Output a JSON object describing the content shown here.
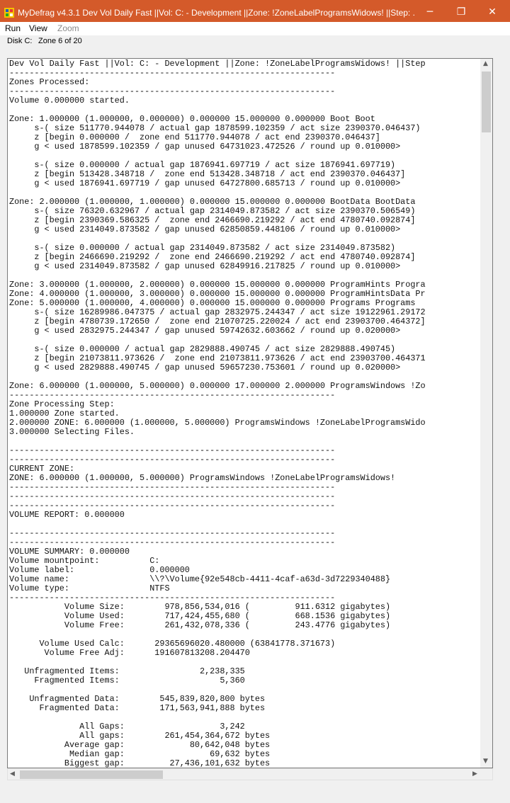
{
  "window": {
    "title": "MyDefrag v4.3.1   Dev Vol Daily Fast ||Vol: C: - Development ||Zone: !ZoneLabelProgramsWidows! ||Step: ...",
    "minimize": "─",
    "maximize": "❐",
    "close": "✕",
    "accent": "#d45a2a"
  },
  "menu": {
    "run": "Run",
    "view": "View",
    "zoom": "Zoom"
  },
  "status": {
    "disk": "Disk C:",
    "zone": "Zone 6 of 20"
  },
  "log_lines": [
    "Dev Vol Daily Fast ||Vol: C: - Development ||Zone: !ZoneLabelProgramsWidows! ||Step",
    "-----------------------------------------------------------------",
    "Zones Processed:",
    "-----------------------------------------------------------------",
    "Volume 0.000000 started.",
    "",
    "Zone: 1.000000 (1.000000, 0.000000) 0.000000 15.000000 0.000000 Boot Boot",
    "     s-( size 511770.944078 / actual gap 1878599.102359 / act size 2390370.046437)",
    "     z [begin 0.000000 /  zone end 511770.944078 / act end 2390370.046437]",
    "     g < used 1878599.102359 / gap unused 64731023.472526 / round up 0.010000>",
    "",
    "     s-( size 0.000000 / actual gap 1876941.697719 / act size 1876941.697719)",
    "     z [begin 513428.348718 /  zone end 513428.348718 / act end 2390370.046437]",
    "     g < used 1876941.697719 / gap unused 64727800.685713 / round up 0.010000>",
    "",
    "Zone: 2.000000 (1.000000, 1.000000) 0.000000 15.000000 0.000000 BootData BootData",
    "     s-( size 76320.632967 / actual gap 2314049.873582 / act size 2390370.506549)",
    "     z [begin 2390369.586325 /  zone end 2466690.219292 / act end 4780740.092874]",
    "     g < used 2314049.873582 / gap unused 62850859.448106 / round up 0.010000>",
    "",
    "     s-( size 0.000000 / actual gap 2314049.873582 / act size 2314049.873582)",
    "     z [begin 2466690.219292 /  zone end 2466690.219292 / act end 4780740.092874]",
    "     g < used 2314049.873582 / gap unused 62849916.217825 / round up 0.010000>",
    "",
    "Zone: 3.000000 (1.000000, 2.000000) 0.000000 15.000000 0.000000 ProgramHints Progra",
    "Zone: 4.000000 (1.000000, 3.000000) 0.000000 15.000000 0.000000 ProgramHintsData Pr",
    "Zone: 5.000000 (1.000000, 4.000000) 0.000000 15.000000 0.000000 Programs Programs",
    "     s-( size 16289986.047375 / actual gap 2832975.244347 / act size 19122961.29172",
    "     z [begin 4780739.172650 /  zone end 21070725.220024 / act end 23903700.464372]",
    "     g < used 2832975.244347 / gap unused 59742632.603662 / round up 0.020000>",
    "",
    "     s-( size 0.000000 / actual gap 2829888.490745 / act size 2829888.490745)",
    "     z [begin 21073811.973626 /  zone end 21073811.973626 / act end 23903700.464371",
    "     g < used 2829888.490745 / gap unused 59657230.753601 / round up 0.020000>",
    "",
    "Zone: 6.000000 (1.000000, 5.000000) 0.000000 17.000000 2.000000 ProgramsWindows !Zo",
    "-----------------------------------------------------------------",
    "Zone Processing Step:",
    "1.000000 Zone started.",
    "2.000000 ZONE: 6.000000 (1.000000, 5.000000) ProgramsWindows !ZoneLabelProgramsWido",
    "3.000000 Selecting Files.",
    "",
    "-----------------------------------------------------------------",
    "-----------------------------------------------------------------",
    "CURRENT ZONE:",
    "ZONE: 6.000000 (1.000000, 5.000000) ProgramsWindows !ZoneLabelProgramsWidows!",
    "-----------------------------------------------------------------",
    "-----------------------------------------------------------------",
    "-----------------------------------------------------------------",
    "VOLUME REPORT: 0.000000",
    "",
    "-----------------------------------------------------------------",
    "-----------------------------------------------------------------",
    "VOLUME SUMMARY: 0.000000",
    "Volume mountpoint:          C:",
    "Volume label:               0.000000",
    "Volume name:                \\\\?\\Volume{92e548cb-4411-4caf-a63d-3d7229340488}",
    "Volume type:                NTFS",
    "-----------------------------------------------------------------",
    "           Volume Size:        978,856,534,016 (         911.6312 gigabytes)",
    "           Volume Used:        717,424,455,680 (         668.1536 gigabytes)",
    "           Volume Free:        261,432,078,336 (         243.4776 gigabytes)",
    "",
    "      Volume Used Calc:      29365696020.480000 (63841778.371673)",
    "       Volume Free Adj:      191607813208.204470",
    "",
    "   Unfragmented Items:                2,238,335",
    "     Fragmented Items:                    5,360",
    "",
    "    Unfragmented Data:        545,839,820,800 bytes",
    "      Fragmented Data:        171,563,941,888 bytes",
    "",
    "              All Gaps:                   3,242",
    "              All gaps:        261,454,364,672 bytes",
    "           Average gap:             80,642,048 bytes",
    "            Median gap:                 69,632 bytes",
    "           Biggest gap:         27,436,101,632 bytes"
  ]
}
